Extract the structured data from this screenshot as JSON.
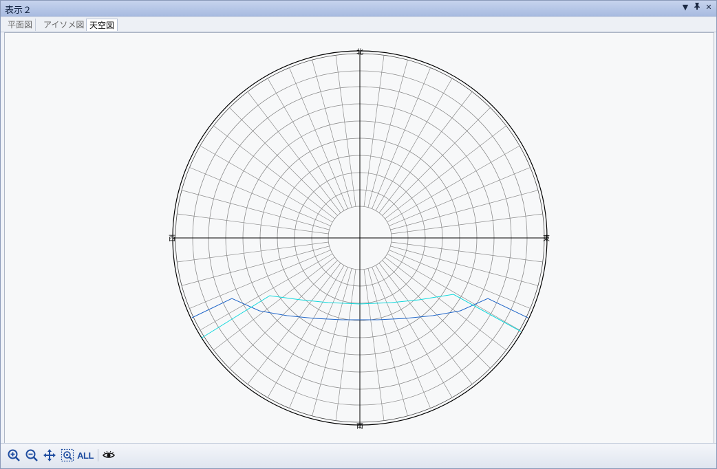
{
  "window": {
    "title": "表示２",
    "buttons": {
      "dropdown": "▼",
      "pin": "ᵽ",
      "close": "✕"
    }
  },
  "tabs": [
    {
      "label": "平面図",
      "active": false
    },
    {
      "label": "アイソメ図",
      "active": false
    },
    {
      "label": "天空図",
      "active": true
    }
  ],
  "skydiagram": {
    "directions": {
      "north": "北",
      "east": "東",
      "south": "南",
      "west": "西"
    },
    "colors": {
      "grid": "#8c8c8c",
      "axis": "#000000",
      "sun_path_1": "#1e64c8",
      "sun_path_2": "#10d8dc"
    }
  },
  "toolbar": {
    "zoom_in": "zoom-in-icon",
    "zoom_out": "zoom-out-icon",
    "pan": "pan-icon",
    "fit": "zoom-fit-icon",
    "all_label": "ALL",
    "view": "eye-icon"
  }
}
